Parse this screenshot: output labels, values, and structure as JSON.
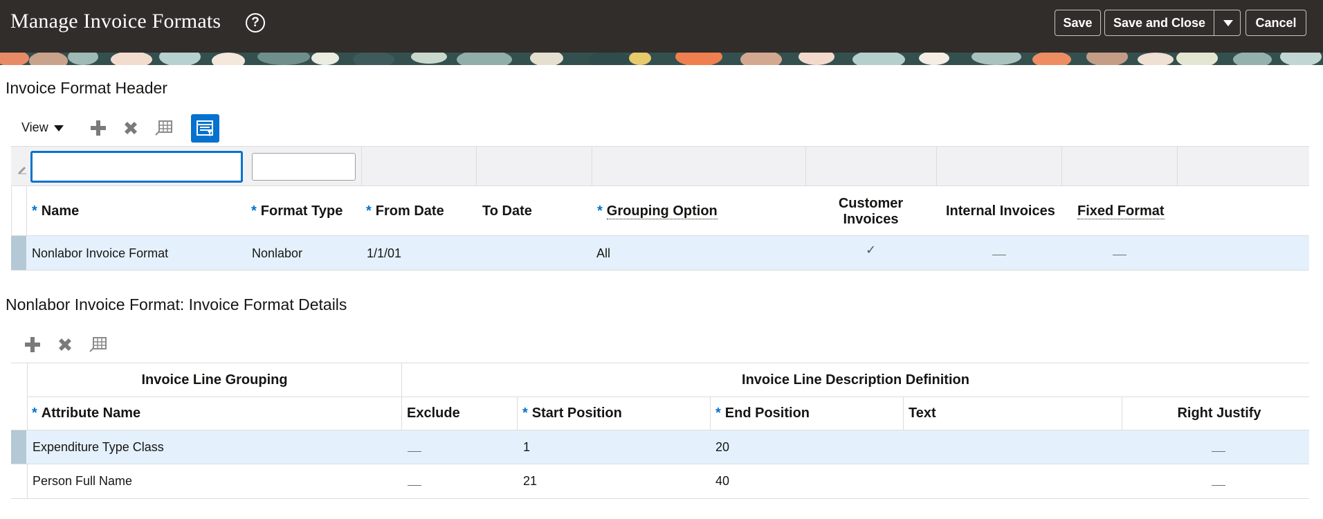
{
  "header": {
    "title": "Manage Invoice Formats",
    "help": "?",
    "save_label": "Save",
    "save_close_label": "Save and Close",
    "cancel_label": "Cancel"
  },
  "format_header": {
    "section_title": "Invoice Format Header",
    "view_label": "View",
    "columns": {
      "name": "Name",
      "format_type": "Format Type",
      "from_date": "From Date",
      "to_date": "To Date",
      "grouping_option": "Grouping Option",
      "customer_invoices_line1": "Customer",
      "customer_invoices_line2": "Invoices",
      "internal_invoices": "Internal Invoices",
      "fixed_format": "Fixed Format"
    },
    "required_marker": "*",
    "rows": [
      {
        "name": "Nonlabor Invoice Format",
        "format_type": "Nonlabor",
        "from_date": "1/1/01",
        "to_date": "",
        "grouping_option": "All",
        "customer_invoices": "✓",
        "internal_invoices": "—",
        "fixed_format": "—"
      }
    ]
  },
  "format_details": {
    "section_title": "Nonlabor Invoice Format: Invoice Format Details",
    "group_headers": {
      "line_grouping": "Invoice Line Grouping",
      "line_description": "Invoice Line Description Definition"
    },
    "columns": {
      "attribute_name": "Attribute Name",
      "exclude": "Exclude",
      "start_position": "Start Position",
      "end_position": "End Position",
      "text": "Text",
      "right_justify": "Right Justify"
    },
    "rows": [
      {
        "attribute_name": "Expenditure Type Class",
        "exclude": "—",
        "start_position": "1",
        "end_position": "20",
        "text": "",
        "right_justify": "—"
      },
      {
        "attribute_name": "Person Full Name",
        "exclude": "—",
        "start_position": "21",
        "end_position": "40",
        "text": "",
        "right_justify": "—"
      }
    ]
  },
  "colors": {
    "header_bg": "#312d2a",
    "accent": "#0572ce",
    "selected_row": "#e4f1fc"
  }
}
